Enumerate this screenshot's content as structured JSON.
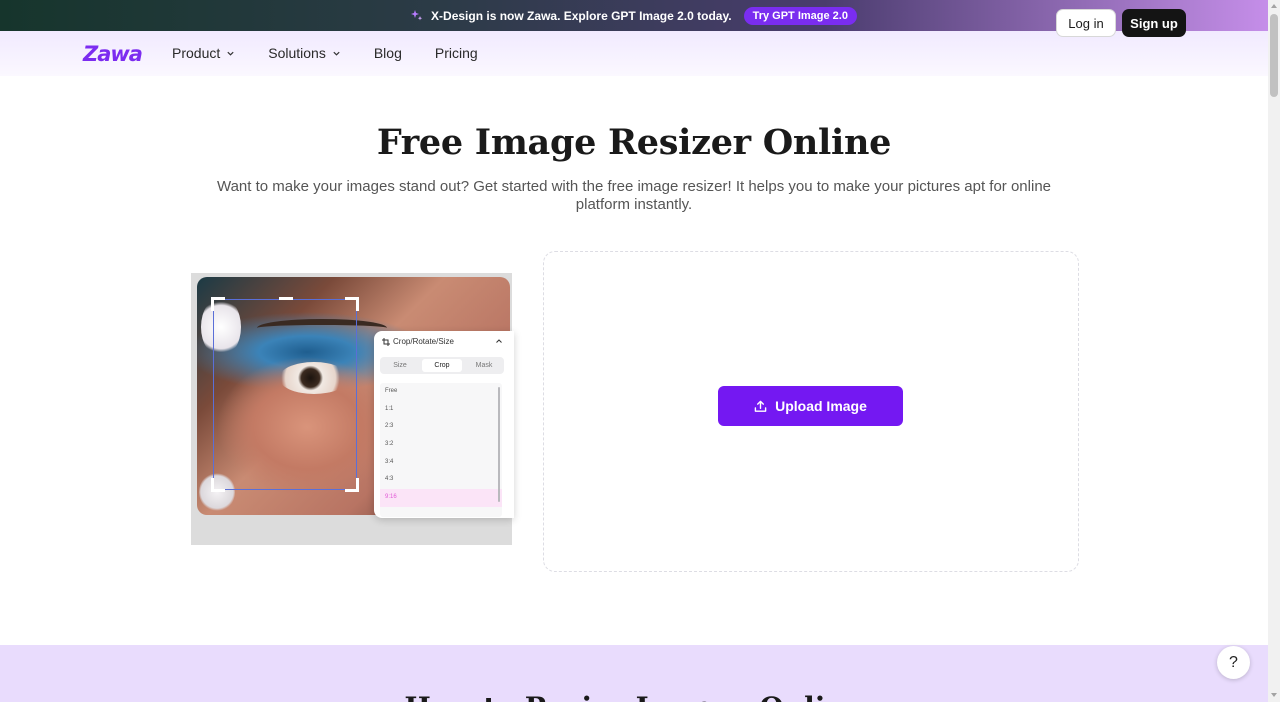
{
  "announcement": {
    "message": "X-Design is now Zawa. Explore GPT Image 2.0 today.",
    "cta": "Try GPT Image 2.0",
    "icon": "sparkle-icon"
  },
  "header": {
    "logo": "Zawa",
    "nav": [
      {
        "label": "Product",
        "has_dropdown": true
      },
      {
        "label": "Solutions",
        "has_dropdown": true
      },
      {
        "label": "Blog",
        "has_dropdown": false
      },
      {
        "label": "Pricing",
        "has_dropdown": false
      }
    ],
    "login_label": "Log in",
    "signup_label": "Sign up"
  },
  "hero": {
    "title": "Free Image Resizer Online",
    "subtitle": "Want to make your images stand out? Get started with the free image resizer! It helps you to make your pictures apt for online platform instantly."
  },
  "preview_panel": {
    "title": "Crop/Rotate/Size",
    "tabs": [
      "Size",
      "Crop",
      "Mask"
    ],
    "active_tab": "Crop",
    "options": [
      "Free",
      "1:1",
      "2:3",
      "3:2",
      "3:4",
      "4:3",
      "9:16"
    ],
    "selected_option": "9:16"
  },
  "upload": {
    "button_label": "Upload Image",
    "icon": "upload-icon"
  },
  "bottom": {
    "title": "How to Resize Images Online"
  },
  "help": {
    "label": "?"
  },
  "colors": {
    "accent": "#7418f2",
    "brand": "#7c2cf0",
    "bottom_bg": "#e9dcfd"
  }
}
